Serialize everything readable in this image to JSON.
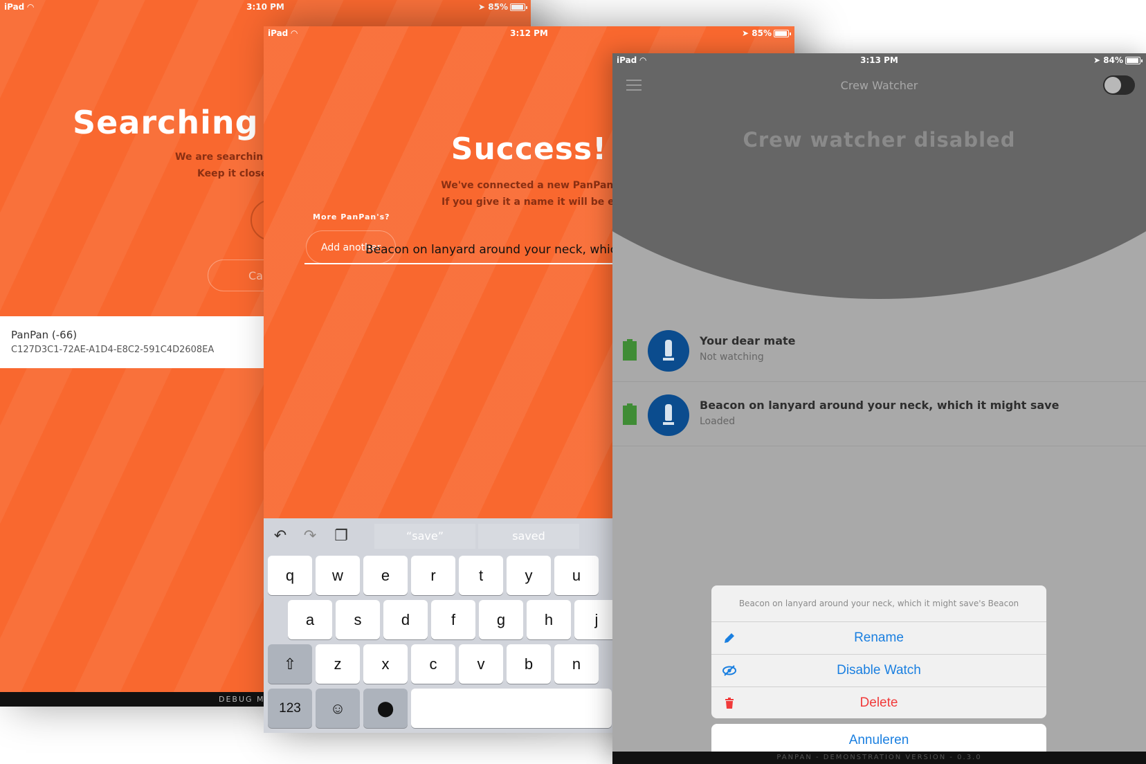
{
  "screen_a": {
    "status": {
      "device": "iPad",
      "time": "3:10 PM",
      "battery": "85%"
    },
    "title": "Searching f",
    "subtitle_line1": "We are searching",
    "subtitle_line2": "Keep it close",
    "cancel_label": "Ca",
    "device_item": {
      "name": "PanPan (-66)",
      "uuid": "C127D3C1-72AE-A1D4-E8C2-591C4D2608EA"
    },
    "debug_label": "DEBUG MO"
  },
  "screen_b": {
    "status": {
      "device": "iPad",
      "time": "3:12 PM",
      "battery": "85%"
    },
    "title": "Success!",
    "subtitle_line1": "We've connected a new PanPan.",
    "subtitle_line2": "If you give it a name it will be easier",
    "more_label": "More PanPan's?",
    "add_another_label": "Add another",
    "name_input_value": "Beacon on lanyard around your neck, which",
    "keyboard": {
      "suggestions": [
        "“save”",
        "saved"
      ],
      "row1": [
        "q",
        "w",
        "e",
        "r",
        "t",
        "y",
        "u"
      ],
      "row2": [
        "a",
        "s",
        "d",
        "f",
        "g",
        "h",
        "j"
      ],
      "row3": [
        "z",
        "x",
        "c",
        "v",
        "b",
        "n"
      ],
      "numbers_key": "123"
    }
  },
  "screen_c": {
    "status": {
      "device": "iPad",
      "time": "3:13 PM",
      "battery": "84%"
    },
    "app_title": "Crew Watcher",
    "watcher_status": "Crew watcher disabled",
    "toggle_on": false,
    "beacons": [
      {
        "name": "Your dear mate",
        "status": "Not watching"
      },
      {
        "name": "Beacon on lanyard around your neck, which it might save",
        "status": "Loaded"
      }
    ],
    "action_sheet": {
      "header": "Beacon on lanyard around your neck, which it might save's Beacon",
      "rename": "Rename",
      "disable_watch": "Disable Watch",
      "delete": "Delete",
      "cancel": "Annuleren"
    },
    "footer": "PANPAN - DEMONSTRATION VERSION - 0.3.0"
  },
  "colors": {
    "orange": "#f9682f",
    "blue": "#1a7fe0",
    "red": "#f13a3a",
    "dark_blue": "#0b4c8e",
    "green": "#3f8c35"
  }
}
